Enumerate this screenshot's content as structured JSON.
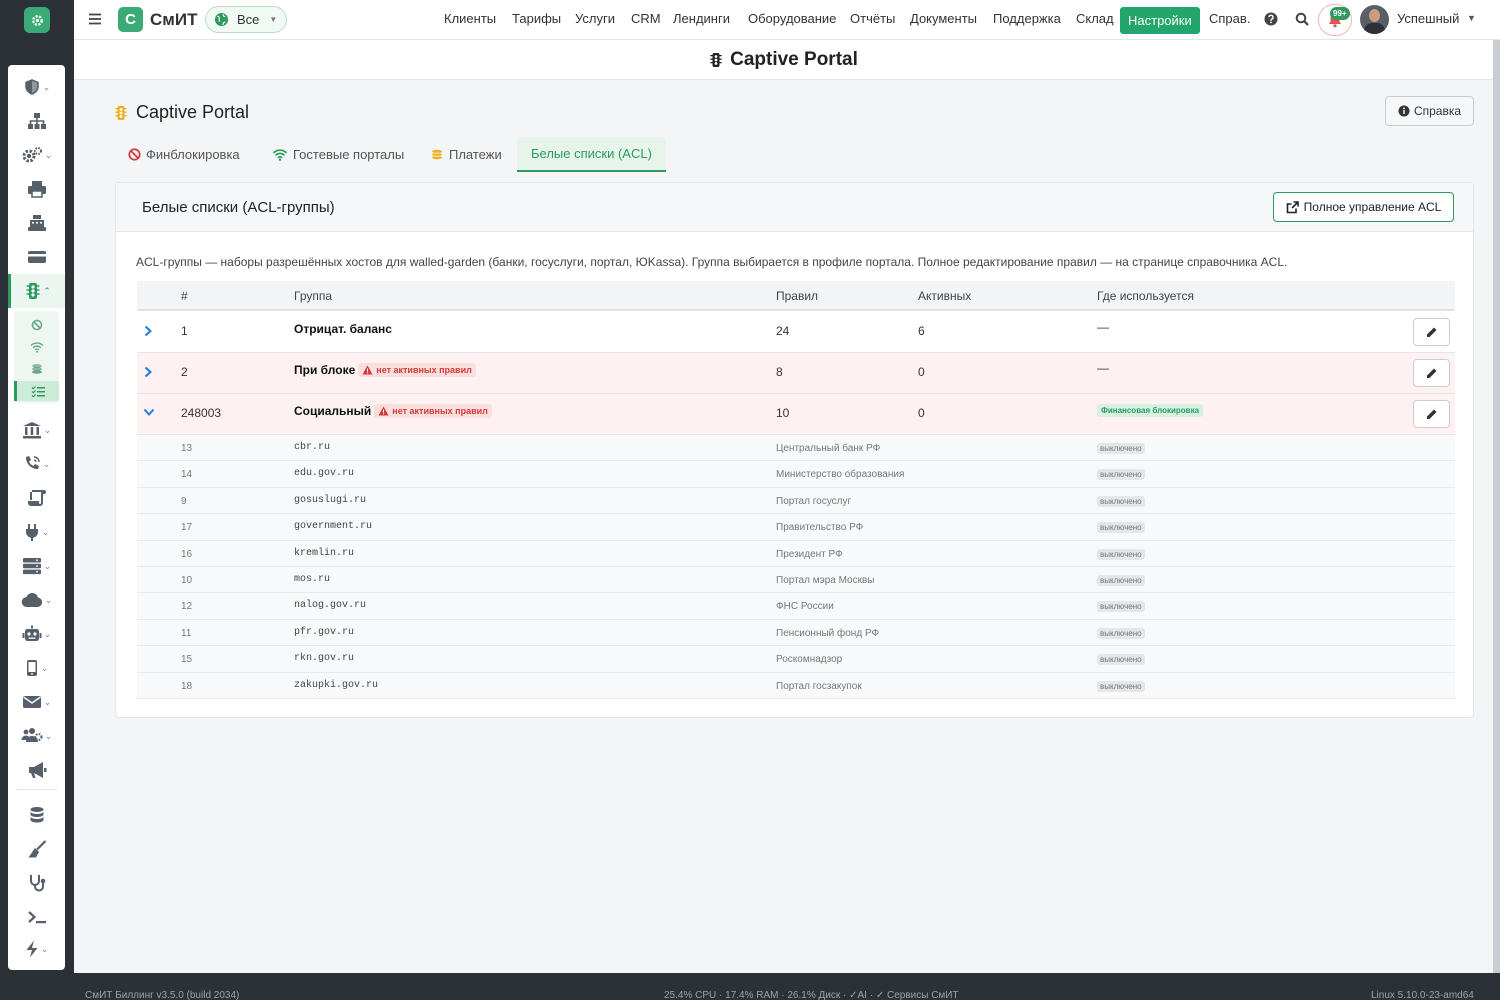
{
  "topbar": {
    "brand_logo_letter": "C",
    "brand_name": "СмИТ",
    "scope_label": "Все",
    "nav": [
      "Клиенты",
      "Тарифы",
      "Услуги",
      "CRM",
      "Лендинги",
      "Оборудование",
      "Отчёты",
      "Документы",
      "Поддержка",
      "Склад",
      "Настройки",
      "Справ."
    ],
    "active_nav": "Настройки",
    "notifications_count": "99+",
    "user_name": "Успешный"
  },
  "page": {
    "header_title": "Captive Portal",
    "title": "Captive Portal",
    "help_button": "Справка"
  },
  "tabs": [
    {
      "label": "Финблокировка",
      "icon": "ban-icon",
      "color": "#d33b3b"
    },
    {
      "label": "Гостевые порталы",
      "icon": "wifi-icon",
      "color": "#2e9a5e"
    },
    {
      "label": "Платежи",
      "icon": "coins-icon",
      "color": "#e9b227"
    },
    {
      "label": "Белые списки (ACL)",
      "active": true
    }
  ],
  "card": {
    "title": "Белые списки (ACL-группы)",
    "acl_button": "Полное управление ACL",
    "description": "ACL-группы — наборы разрешённых хостов для walled-garden (банки, госуслуги, портал, ЮKassa). Группа выбирается в профиле портала. Полное редактирование правил — на странице справочника ACL."
  },
  "table": {
    "headers": [
      "#",
      "Группа",
      "Правил",
      "Активных",
      "Где используется"
    ],
    "rows": [
      {
        "id": "1",
        "name": "Отрицат. баланс",
        "badge": "",
        "rules": "24",
        "active": "6",
        "used": "—",
        "expanded": false
      },
      {
        "id": "2",
        "name": "При блоке",
        "badge": "нет активных правил",
        "rules": "8",
        "active": "0",
        "used": "—",
        "expanded": false
      },
      {
        "id": "248003",
        "name": "Социальный",
        "badge": "нет активных правил",
        "rules": "10",
        "active": "0",
        "used": "Финансовая блокировка",
        "expanded": true
      }
    ],
    "sub_rows": [
      {
        "id": "13",
        "host": "cbr.ru",
        "desc": "Центральный банк РФ",
        "status": "выключено"
      },
      {
        "id": "14",
        "host": "edu.gov.ru",
        "desc": "Министерство образования",
        "status": "выключено"
      },
      {
        "id": "9",
        "host": "gosuslugi.ru",
        "desc": "Портал госуслуг",
        "status": "выключено"
      },
      {
        "id": "17",
        "host": "government.ru",
        "desc": "Правительство РФ",
        "status": "выключено"
      },
      {
        "id": "16",
        "host": "kremlin.ru",
        "desc": "Президент РФ",
        "status": "выключено"
      },
      {
        "id": "10",
        "host": "mos.ru",
        "desc": "Портал мэра Москвы",
        "status": "выключено"
      },
      {
        "id": "12",
        "host": "nalog.gov.ru",
        "desc": "ФНС России",
        "status": "выключено"
      },
      {
        "id": "11",
        "host": "pfr.gov.ru",
        "desc": "Пенсионный фонд РФ",
        "status": "выключено"
      },
      {
        "id": "15",
        "host": "rkn.gov.ru",
        "desc": "Роскомнадзор",
        "status": "выключено"
      },
      {
        "id": "18",
        "host": "zakupki.gov.ru",
        "desc": "Портал госзакупок",
        "status": "выключено"
      }
    ]
  },
  "footer": {
    "left": "СмИТ Биллинг v3.5.0 (build 2034)",
    "center": "25.4% CPU · 17.4% RAM · 26.1% Диск · ✓AI · ✓ Сервисы СмИТ",
    "right": "Linux 5.10.0-23-amd64"
  },
  "colors": {
    "accent": "#2e9a5e",
    "danger": "#d33b3b",
    "link": "#1d7be0",
    "warning": "#e9b227"
  }
}
